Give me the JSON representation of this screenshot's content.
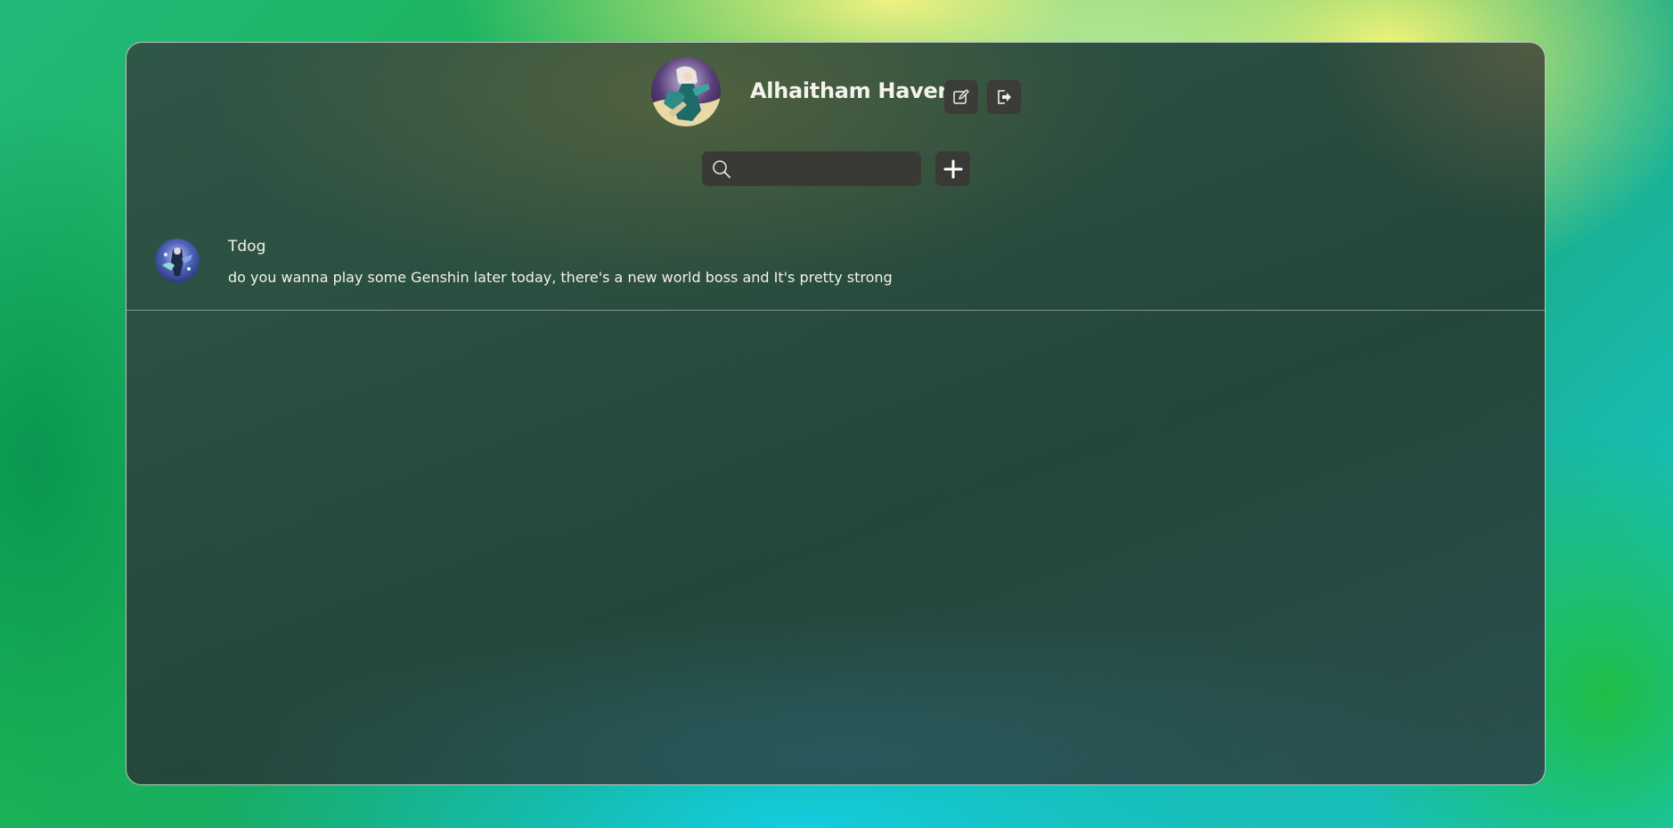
{
  "header": {
    "user_name": "Alhaitham Haver",
    "avatar_icon": "user-avatar-portrait",
    "edit_icon": "edit-icon",
    "logout_icon": "logout-icon"
  },
  "search": {
    "placeholder": "",
    "value": "",
    "icon": "search-icon"
  },
  "add_button": {
    "icon": "plus-icon"
  },
  "chats": [
    {
      "name": "Tdog",
      "message": "do you wanna play some Genshin later today, there's a new world boss and It's pretty strong",
      "avatar_icon": "contact-avatar-portrait"
    }
  ],
  "colors": {
    "button_bg": "#3b3b38",
    "text": "#f2f2ee",
    "window_border": "#d2dcd7"
  }
}
